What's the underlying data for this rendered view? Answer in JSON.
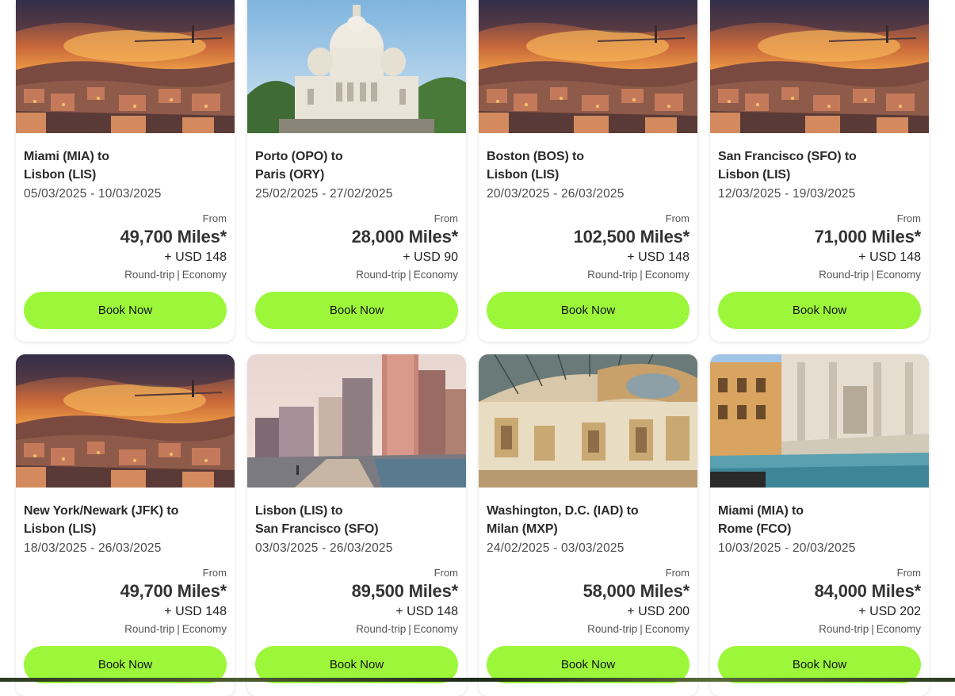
{
  "cards": [
    {
      "image": "lisbon-sunset-photo",
      "route_from": "Miami (MIA) to",
      "route_to": "Lisbon (LIS)",
      "dates": "05/03/2025 - 10/03/2025",
      "from_label": "From",
      "miles": "49,700 Miles*",
      "usd": "+ USD 148",
      "trip_type": "Round-trip",
      "cabin": "Economy",
      "button": "Book Now"
    },
    {
      "image": "paris-sacre-coeur-photo",
      "route_from": "Porto (OPO) to",
      "route_to": "Paris (ORY)",
      "dates": "25/02/2025 - 27/02/2025",
      "from_label": "From",
      "miles": "28,000 Miles*",
      "usd": "+ USD 90",
      "trip_type": "Round-trip",
      "cabin": "Economy",
      "button": "Book Now"
    },
    {
      "image": "lisbon-sunset-photo",
      "route_from": "Boston (BOS) to",
      "route_to": "Lisbon (LIS)",
      "dates": "20/03/2025 - 26/03/2025",
      "from_label": "From",
      "miles": "102,500 Miles*",
      "usd": "+ USD 148",
      "trip_type": "Round-trip",
      "cabin": "Economy",
      "button": "Book Now"
    },
    {
      "image": "lisbon-sunset-photo",
      "route_from": "San Francisco (SFO) to",
      "route_to": "Lisbon (LIS)",
      "dates": "12/03/2025 - 19/03/2025",
      "from_label": "From",
      "miles": "71,000 Miles*",
      "usd": "+ USD 148",
      "trip_type": "Round-trip",
      "cabin": "Economy",
      "button": "Book Now"
    },
    {
      "image": "lisbon-sunset-photo",
      "route_from": "New York/Newark (JFK) to",
      "route_to": "Lisbon (LIS)",
      "dates": "18/03/2025 - 26/03/2025",
      "from_label": "From",
      "miles": "49,700 Miles*",
      "usd": "+ USD 148",
      "trip_type": "Round-trip",
      "cabin": "Economy",
      "button": "Book Now"
    },
    {
      "image": "san-francisco-skyline-photo",
      "route_from": "Lisbon (LIS) to",
      "route_to": "San Francisco (SFO)",
      "dates": "03/03/2025 - 26/03/2025",
      "from_label": "From",
      "miles": "89,500 Miles*",
      "usd": "+ USD 148",
      "trip_type": "Round-trip",
      "cabin": "Economy",
      "button": "Book Now"
    },
    {
      "image": "milan-galleria-photo",
      "route_from": "Washington, D.C. (IAD) to",
      "route_to": "Milan (MXP)",
      "dates": "24/02/2025 - 03/03/2025",
      "from_label": "From",
      "miles": "58,000 Miles*",
      "usd": "+ USD 200",
      "trip_type": "Round-trip",
      "cabin": "Economy",
      "button": "Book Now"
    },
    {
      "image": "rome-trevi-fountain-photo",
      "route_from": "Miami (MIA) to",
      "route_to": "Rome (FCO)",
      "dates": "10/03/2025 - 20/03/2025",
      "from_label": "From",
      "miles": "84,000 Miles*",
      "usd": "+ USD 202",
      "trip_type": "Round-trip",
      "cabin": "Economy",
      "button": "Book Now"
    }
  ],
  "colors": {
    "button_bg": "#9cf73a",
    "card_bg": "#ffffff",
    "text": "#2a2a2a"
  }
}
